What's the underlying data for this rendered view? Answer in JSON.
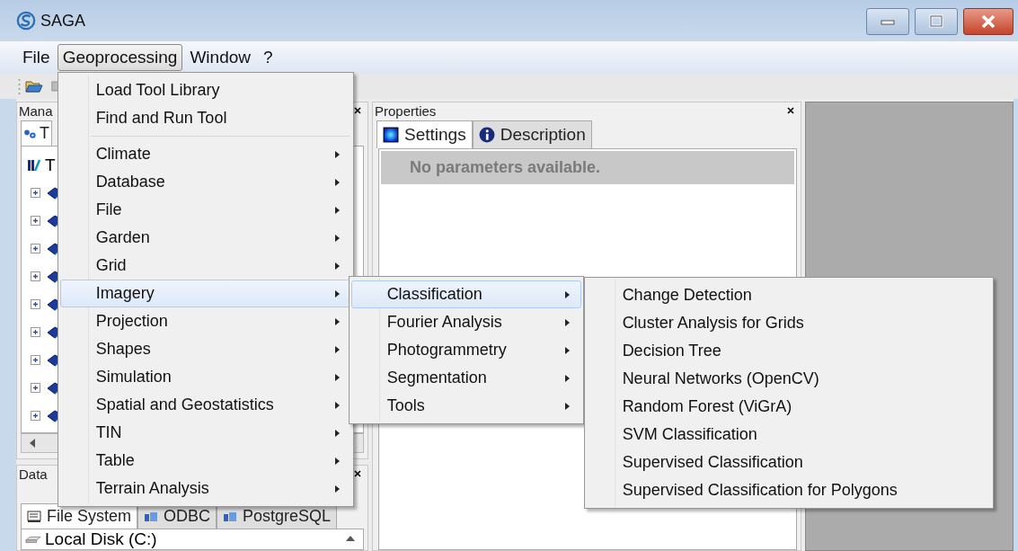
{
  "window": {
    "title": "SAGA"
  },
  "menu_bar": [
    {
      "label": "File",
      "selected": false
    },
    {
      "label": "Geoprocessing",
      "selected": true
    },
    {
      "label": "Window",
      "selected": false
    },
    {
      "label": "?",
      "selected": false
    }
  ],
  "manager_panel": {
    "title": "Mana",
    "tab": "T",
    "tree_root": "T",
    "tree_nodes": [
      {
        "expanded": false
      },
      {
        "expanded": false
      },
      {
        "expanded": false
      },
      {
        "expanded": false
      },
      {
        "expanded": false
      },
      {
        "expanded": false
      },
      {
        "expanded": false
      },
      {
        "expanded": false
      },
      {
        "expanded": false
      }
    ]
  },
  "data_panel": {
    "title": "Data",
    "tabs": [
      {
        "label": "File System",
        "selected": true
      },
      {
        "label": "ODBC",
        "selected": false
      },
      {
        "label": "PostgreSQL",
        "selected": false
      }
    ],
    "items": [
      "Local Disk (C:)"
    ]
  },
  "properties_panel": {
    "title": "Properties",
    "tabs": [
      {
        "label": "Settings",
        "selected": true
      },
      {
        "label": "Description",
        "selected": false
      }
    ],
    "message": "No parameters available."
  },
  "geoprocessing_menu": [
    {
      "kind": "command",
      "label": "Load Tool Library",
      "selected": false
    },
    {
      "kind": "command",
      "label": "Find and Run Tool",
      "selected": false
    },
    {
      "kind": "separator"
    },
    {
      "kind": "submenu",
      "label": "Climate",
      "selected": false
    },
    {
      "kind": "submenu",
      "label": "Database",
      "selected": false
    },
    {
      "kind": "submenu",
      "label": "File",
      "selected": false
    },
    {
      "kind": "submenu",
      "label": "Garden",
      "selected": false
    },
    {
      "kind": "submenu",
      "label": "Grid",
      "selected": false
    },
    {
      "kind": "submenu",
      "label": "Imagery",
      "selected": true
    },
    {
      "kind": "submenu",
      "label": "Projection",
      "selected": false
    },
    {
      "kind": "submenu",
      "label": "Shapes",
      "selected": false
    },
    {
      "kind": "submenu",
      "label": "Simulation",
      "selected": false
    },
    {
      "kind": "submenu",
      "label": "Spatial and Geostatistics",
      "selected": false
    },
    {
      "kind": "submenu",
      "label": "TIN",
      "selected": false
    },
    {
      "kind": "submenu",
      "label": "Table",
      "selected": false
    },
    {
      "kind": "submenu",
      "label": "Terrain Analysis",
      "selected": false
    }
  ],
  "imagery_menu": [
    {
      "kind": "submenu",
      "label": "Classification",
      "selected": true
    },
    {
      "kind": "submenu",
      "label": "Fourier Analysis",
      "selected": false
    },
    {
      "kind": "submenu",
      "label": "Photogrammetry",
      "selected": false
    },
    {
      "kind": "submenu",
      "label": "Segmentation",
      "selected": false
    },
    {
      "kind": "submenu",
      "label": "Tools",
      "selected": false
    }
  ],
  "classification_menu": [
    {
      "kind": "command",
      "label": "Change Detection",
      "selected": false
    },
    {
      "kind": "command",
      "label": "Cluster Analysis for Grids",
      "selected": false
    },
    {
      "kind": "command",
      "label": "Decision Tree",
      "selected": false
    },
    {
      "kind": "command",
      "label": "Neural Networks (OpenCV)",
      "selected": false
    },
    {
      "kind": "command",
      "label": "Random Forest (ViGrA)",
      "selected": false
    },
    {
      "kind": "command",
      "label": "SVM Classification",
      "selected": false
    },
    {
      "kind": "command",
      "label": "Supervised Classification",
      "selected": false
    },
    {
      "kind": "command",
      "label": "Supervised Classification for Polygons",
      "selected": false
    }
  ]
}
